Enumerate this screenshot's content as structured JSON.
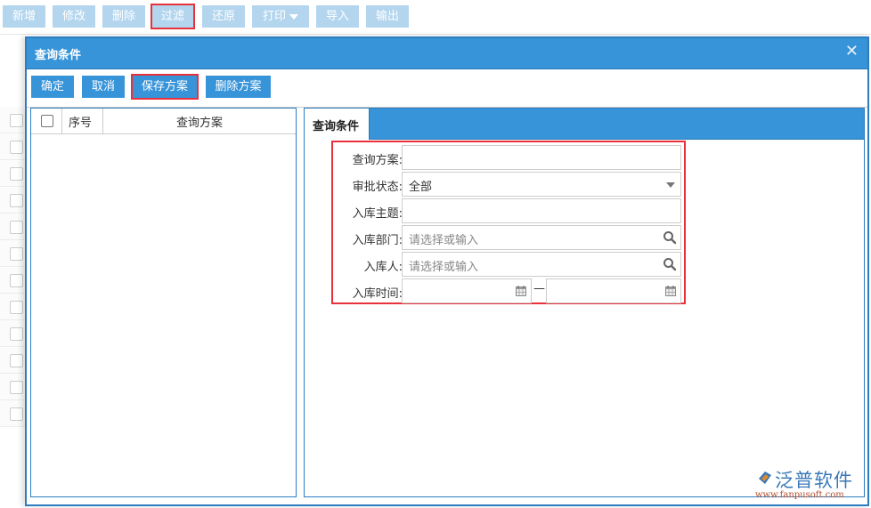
{
  "toolbar": {
    "buttons": [
      {
        "label": "新增"
      },
      {
        "label": "修改"
      },
      {
        "label": "删除"
      },
      {
        "label": "过滤",
        "highlighted": true
      },
      {
        "label": "还原"
      },
      {
        "label": "打印",
        "has_dropdown": true
      },
      {
        "label": "导入"
      },
      {
        "label": "输出"
      }
    ]
  },
  "background_list": {
    "row_count": 12
  },
  "dialog": {
    "title": "查询条件",
    "close_icon": "close-icon",
    "actions": {
      "confirm": "确定",
      "cancel": "取消",
      "save_scheme": "保存方案",
      "delete_scheme": "删除方案"
    },
    "scheme_table": {
      "columns": [
        "序号",
        "查询方案"
      ],
      "rows": []
    },
    "tab": "查询条件",
    "form": {
      "fields": [
        {
          "label": "查询方案:",
          "type": "text",
          "value": ""
        },
        {
          "label": "审批状态:",
          "type": "select",
          "value": "全部"
        },
        {
          "label": "入库主题:",
          "type": "text",
          "value": ""
        },
        {
          "label": "入库部门:",
          "type": "lookup",
          "placeholder": "请选择或输入"
        },
        {
          "label": "入库人:",
          "type": "lookup",
          "placeholder": "请选择或输入"
        },
        {
          "label": "入库时间:",
          "type": "daterange",
          "from": "",
          "to": "",
          "separator": "—"
        }
      ]
    }
  },
  "branding": {
    "name": "泛普软件",
    "url": "www.fanpusoft.com"
  },
  "colors": {
    "primary": "#3794d9",
    "toolbar_button": "#b3d5ee",
    "highlight": "#e8313a",
    "border": "#2d7dbf"
  }
}
